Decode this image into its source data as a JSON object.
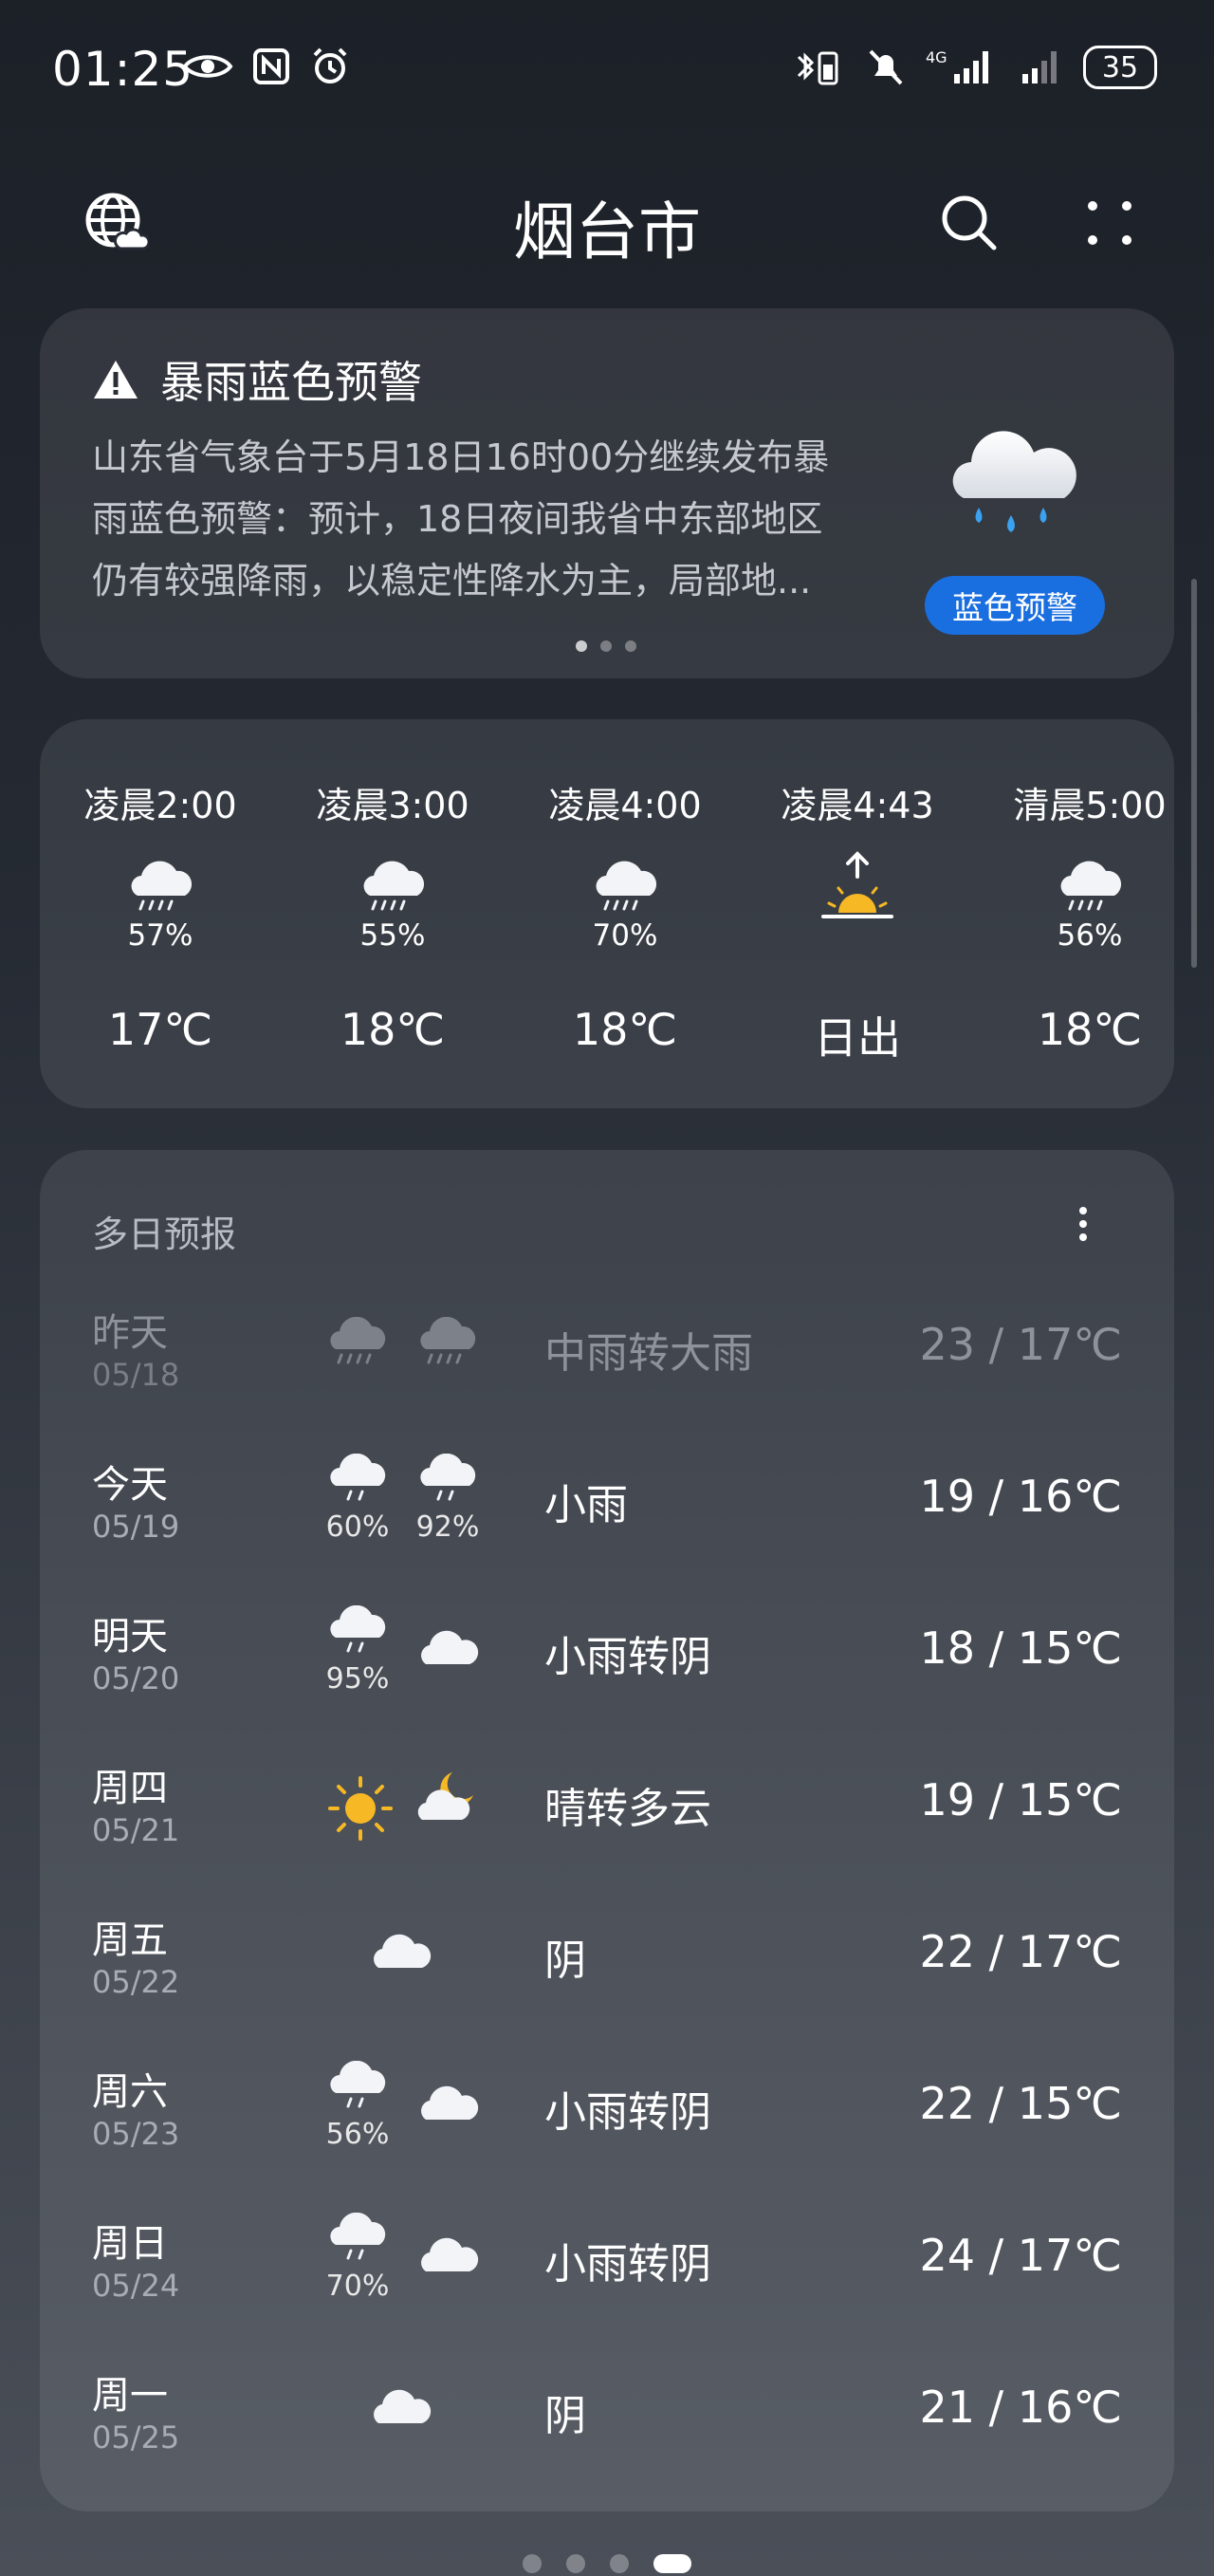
{
  "status_bar": {
    "time": "01:25",
    "battery": "35",
    "network": "4G"
  },
  "header": {
    "title": "烟台市"
  },
  "warning": {
    "title": "暴雨蓝色预警",
    "lines": [
      "山东省气象台于5月18日16时00分继续发布暴",
      "雨蓝色预警：预计，18日夜间我省中东部地区",
      "仍有较强降雨，以稳定性降水为主，局部地..."
    ],
    "badge": "蓝色预警",
    "badge_color": "#1a6fe0"
  },
  "hourly": [
    {
      "time": "凌晨2:00",
      "icon": "rain-cloud-icon",
      "pct": "57%",
      "temp": "17℃"
    },
    {
      "time": "凌晨3:00",
      "icon": "rain-cloud-icon",
      "pct": "55%",
      "temp": "18℃"
    },
    {
      "time": "凌晨4:00",
      "icon": "rain-cloud-icon",
      "pct": "70%",
      "temp": "18℃"
    },
    {
      "time": "凌晨4:43",
      "icon": "sunrise-icon",
      "pct": "",
      "temp": "日出"
    },
    {
      "time": "清晨5:00",
      "icon": "rain-cloud-icon",
      "pct": "56%",
      "temp": "18℃"
    }
  ],
  "daily": {
    "title": "多日预报",
    "days": [
      {
        "name": "昨天",
        "date": "05/18",
        "icon1": "heavy-rain-icon",
        "pct1": "",
        "icon2": "heavy-rain-icon",
        "pct2": "",
        "desc": "中雨转大雨",
        "temp": "23 / 17℃"
      },
      {
        "name": "今天",
        "date": "05/19",
        "icon1": "light-rain-icon",
        "pct1": "60%",
        "icon2": "light-rain-icon",
        "pct2": "92%",
        "desc": "小雨",
        "temp": "19 / 16℃"
      },
      {
        "name": "明天",
        "date": "05/20",
        "icon1": "light-rain-icon",
        "pct1": "95%",
        "icon2": "cloudy-icon",
        "pct2": "",
        "desc": "小雨转阴",
        "temp": "18 / 15℃"
      },
      {
        "name": "周四",
        "date": "05/21",
        "icon1": "sun-icon",
        "pct1": "",
        "icon2": "moon-cloud-icon",
        "pct2": "",
        "desc": "晴转多云",
        "temp": "19 / 15℃"
      },
      {
        "name": "周五",
        "date": "05/22",
        "icon1": "cloudy-icon",
        "pct1": "",
        "icon2": "",
        "pct2": "",
        "desc": "阴",
        "temp": "22 / 17℃"
      },
      {
        "name": "周六",
        "date": "05/23",
        "icon1": "light-rain-icon",
        "pct1": "56%",
        "icon2": "cloudy-icon",
        "pct2": "",
        "desc": "小雨转阴",
        "temp": "22 / 15℃"
      },
      {
        "name": "周日",
        "date": "05/24",
        "icon1": "light-rain-icon",
        "pct1": "70%",
        "icon2": "cloudy-icon",
        "pct2": "",
        "desc": "小雨转阴",
        "temp": "24 / 17℃"
      },
      {
        "name": "周一",
        "date": "05/25",
        "icon1": "cloudy-icon",
        "pct1": "",
        "icon2": "",
        "pct2": "",
        "desc": "阴",
        "temp": "21 / 16℃"
      }
    ]
  },
  "pager": {
    "count": 4,
    "active": 3
  }
}
